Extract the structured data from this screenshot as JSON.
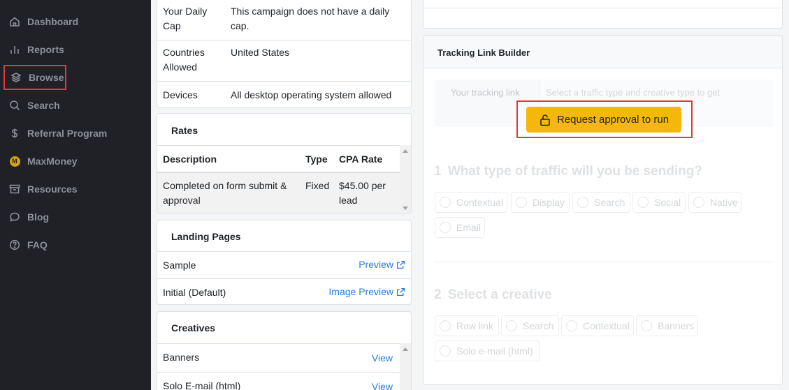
{
  "sidebar": {
    "items": [
      {
        "label": "Dashboard",
        "icon": "home-icon"
      },
      {
        "label": "Reports",
        "icon": "bar-chart-icon"
      },
      {
        "label": "Browse",
        "icon": "layers-icon"
      },
      {
        "label": "Search",
        "icon": "search-icon"
      },
      {
        "label": "Referral Program",
        "icon": "dollar-icon"
      },
      {
        "label": "MaxMoney",
        "icon": "maxmoney-coin-icon"
      },
      {
        "label": "Resources",
        "icon": "archive-icon"
      },
      {
        "label": "Blog",
        "icon": "chat-bubble-icon"
      },
      {
        "label": "FAQ",
        "icon": "question-circle-icon"
      }
    ],
    "maxmoney_glyph": "M",
    "highlight_color": "#e0393e"
  },
  "details": {
    "daily_cap_label_1": "Your Daily",
    "daily_cap_label_2": "Cap",
    "daily_cap_value_1": "This campaign does not have a daily",
    "daily_cap_value_2": "cap.",
    "countries_label_1": "Countries",
    "countries_label_2": "Allowed",
    "countries_value": "United States",
    "devices_label": "Devices",
    "devices_value": "All desktop operating system allowed"
  },
  "rates": {
    "title": "Rates",
    "headers": {
      "description": "Description",
      "type": "Type",
      "cpa": "CPA Rate"
    },
    "row": {
      "description_1": "Completed on form submit &",
      "description_2": "approval",
      "type": "Fixed",
      "cpa_1": "$45.00 per",
      "cpa_2": "lead"
    }
  },
  "landing_pages": {
    "title": "Landing Pages",
    "items": [
      {
        "name": "Sample",
        "link": "Preview"
      },
      {
        "name": "Initial (Default)",
        "link": "Image Preview"
      }
    ]
  },
  "creatives": {
    "title": "Creatives",
    "items": [
      {
        "name": "Banners",
        "link": "View"
      },
      {
        "name": "Solo E-mail (html)",
        "link": "View"
      }
    ]
  },
  "tracking": {
    "title": "Tracking Link Builder",
    "label": "Your tracking link",
    "placeholder": "Select a traffic type and creative type to get",
    "button": "Request approval to run",
    "button_color": "#f5b80a",
    "step1_num": "1",
    "step1": "What type of traffic will you be sending?",
    "traffic_options": [
      "Contextual",
      "Display",
      "Search",
      "Social",
      "Native",
      "Email"
    ],
    "step2_num": "2",
    "step2": "Select a creative",
    "creative_options": [
      "Raw link",
      "Search",
      "Contextual",
      "Banners",
      "Solo e-mail (html)"
    ]
  }
}
